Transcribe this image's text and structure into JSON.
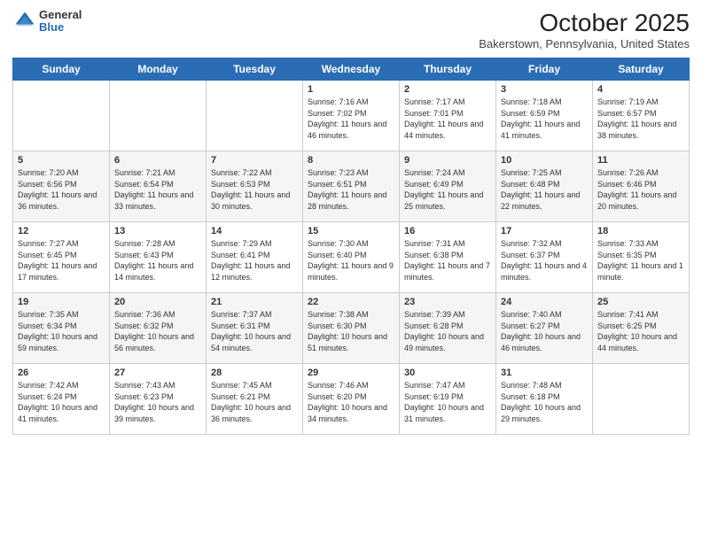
{
  "logo": {
    "general": "General",
    "blue": "Blue"
  },
  "header": {
    "month": "October 2025",
    "location": "Bakerstown, Pennsylvania, United States"
  },
  "weekdays": [
    "Sunday",
    "Monday",
    "Tuesday",
    "Wednesday",
    "Thursday",
    "Friday",
    "Saturday"
  ],
  "weeks": [
    [
      {
        "day": "",
        "sunrise": "",
        "sunset": "",
        "daylight": ""
      },
      {
        "day": "",
        "sunrise": "",
        "sunset": "",
        "daylight": ""
      },
      {
        "day": "",
        "sunrise": "",
        "sunset": "",
        "daylight": ""
      },
      {
        "day": "1",
        "sunrise": "Sunrise: 7:16 AM",
        "sunset": "Sunset: 7:02 PM",
        "daylight": "Daylight: 11 hours and 46 minutes."
      },
      {
        "day": "2",
        "sunrise": "Sunrise: 7:17 AM",
        "sunset": "Sunset: 7:01 PM",
        "daylight": "Daylight: 11 hours and 44 minutes."
      },
      {
        "day": "3",
        "sunrise": "Sunrise: 7:18 AM",
        "sunset": "Sunset: 6:59 PM",
        "daylight": "Daylight: 11 hours and 41 minutes."
      },
      {
        "day": "4",
        "sunrise": "Sunrise: 7:19 AM",
        "sunset": "Sunset: 6:57 PM",
        "daylight": "Daylight: 11 hours and 38 minutes."
      }
    ],
    [
      {
        "day": "5",
        "sunrise": "Sunrise: 7:20 AM",
        "sunset": "Sunset: 6:56 PM",
        "daylight": "Daylight: 11 hours and 36 minutes."
      },
      {
        "day": "6",
        "sunrise": "Sunrise: 7:21 AM",
        "sunset": "Sunset: 6:54 PM",
        "daylight": "Daylight: 11 hours and 33 minutes."
      },
      {
        "day": "7",
        "sunrise": "Sunrise: 7:22 AM",
        "sunset": "Sunset: 6:53 PM",
        "daylight": "Daylight: 11 hours and 30 minutes."
      },
      {
        "day": "8",
        "sunrise": "Sunrise: 7:23 AM",
        "sunset": "Sunset: 6:51 PM",
        "daylight": "Daylight: 11 hours and 28 minutes."
      },
      {
        "day": "9",
        "sunrise": "Sunrise: 7:24 AM",
        "sunset": "Sunset: 6:49 PM",
        "daylight": "Daylight: 11 hours and 25 minutes."
      },
      {
        "day": "10",
        "sunrise": "Sunrise: 7:25 AM",
        "sunset": "Sunset: 6:48 PM",
        "daylight": "Daylight: 11 hours and 22 minutes."
      },
      {
        "day": "11",
        "sunrise": "Sunrise: 7:26 AM",
        "sunset": "Sunset: 6:46 PM",
        "daylight": "Daylight: 11 hours and 20 minutes."
      }
    ],
    [
      {
        "day": "12",
        "sunrise": "Sunrise: 7:27 AM",
        "sunset": "Sunset: 6:45 PM",
        "daylight": "Daylight: 11 hours and 17 minutes."
      },
      {
        "day": "13",
        "sunrise": "Sunrise: 7:28 AM",
        "sunset": "Sunset: 6:43 PM",
        "daylight": "Daylight: 11 hours and 14 minutes."
      },
      {
        "day": "14",
        "sunrise": "Sunrise: 7:29 AM",
        "sunset": "Sunset: 6:41 PM",
        "daylight": "Daylight: 11 hours and 12 minutes."
      },
      {
        "day": "15",
        "sunrise": "Sunrise: 7:30 AM",
        "sunset": "Sunset: 6:40 PM",
        "daylight": "Daylight: 11 hours and 9 minutes."
      },
      {
        "day": "16",
        "sunrise": "Sunrise: 7:31 AM",
        "sunset": "Sunset: 6:38 PM",
        "daylight": "Daylight: 11 hours and 7 minutes."
      },
      {
        "day": "17",
        "sunrise": "Sunrise: 7:32 AM",
        "sunset": "Sunset: 6:37 PM",
        "daylight": "Daylight: 11 hours and 4 minutes."
      },
      {
        "day": "18",
        "sunrise": "Sunrise: 7:33 AM",
        "sunset": "Sunset: 6:35 PM",
        "daylight": "Daylight: 11 hours and 1 minute."
      }
    ],
    [
      {
        "day": "19",
        "sunrise": "Sunrise: 7:35 AM",
        "sunset": "Sunset: 6:34 PM",
        "daylight": "Daylight: 10 hours and 59 minutes."
      },
      {
        "day": "20",
        "sunrise": "Sunrise: 7:36 AM",
        "sunset": "Sunset: 6:32 PM",
        "daylight": "Daylight: 10 hours and 56 minutes."
      },
      {
        "day": "21",
        "sunrise": "Sunrise: 7:37 AM",
        "sunset": "Sunset: 6:31 PM",
        "daylight": "Daylight: 10 hours and 54 minutes."
      },
      {
        "day": "22",
        "sunrise": "Sunrise: 7:38 AM",
        "sunset": "Sunset: 6:30 PM",
        "daylight": "Daylight: 10 hours and 51 minutes."
      },
      {
        "day": "23",
        "sunrise": "Sunrise: 7:39 AM",
        "sunset": "Sunset: 6:28 PM",
        "daylight": "Daylight: 10 hours and 49 minutes."
      },
      {
        "day": "24",
        "sunrise": "Sunrise: 7:40 AM",
        "sunset": "Sunset: 6:27 PM",
        "daylight": "Daylight: 10 hours and 46 minutes."
      },
      {
        "day": "25",
        "sunrise": "Sunrise: 7:41 AM",
        "sunset": "Sunset: 6:25 PM",
        "daylight": "Daylight: 10 hours and 44 minutes."
      }
    ],
    [
      {
        "day": "26",
        "sunrise": "Sunrise: 7:42 AM",
        "sunset": "Sunset: 6:24 PM",
        "daylight": "Daylight: 10 hours and 41 minutes."
      },
      {
        "day": "27",
        "sunrise": "Sunrise: 7:43 AM",
        "sunset": "Sunset: 6:23 PM",
        "daylight": "Daylight: 10 hours and 39 minutes."
      },
      {
        "day": "28",
        "sunrise": "Sunrise: 7:45 AM",
        "sunset": "Sunset: 6:21 PM",
        "daylight": "Daylight: 10 hours and 36 minutes."
      },
      {
        "day": "29",
        "sunrise": "Sunrise: 7:46 AM",
        "sunset": "Sunset: 6:20 PM",
        "daylight": "Daylight: 10 hours and 34 minutes."
      },
      {
        "day": "30",
        "sunrise": "Sunrise: 7:47 AM",
        "sunset": "Sunset: 6:19 PM",
        "daylight": "Daylight: 10 hours and 31 minutes."
      },
      {
        "day": "31",
        "sunrise": "Sunrise: 7:48 AM",
        "sunset": "Sunset: 6:18 PM",
        "daylight": "Daylight: 10 hours and 29 minutes."
      },
      {
        "day": "",
        "sunrise": "",
        "sunset": "",
        "daylight": ""
      }
    ]
  ]
}
